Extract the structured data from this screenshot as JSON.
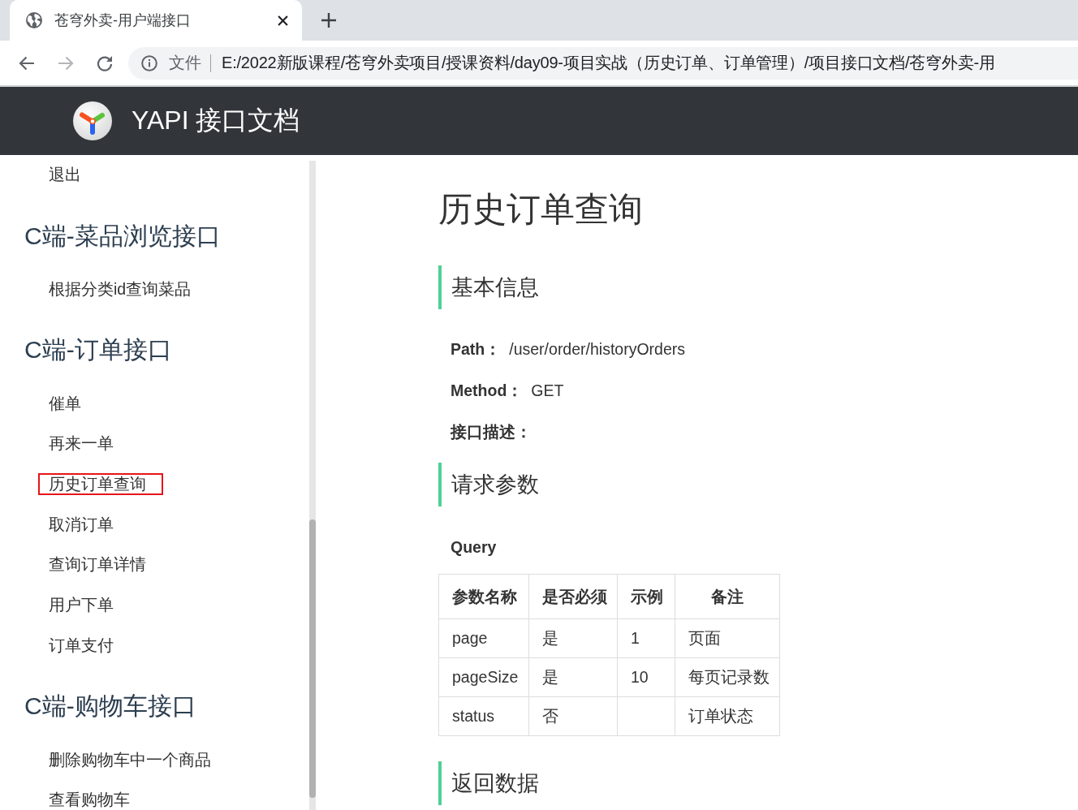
{
  "tabs": [
    {
      "title": "苍穹外卖-用户端接口",
      "selected": true
    }
  ],
  "toolbar": {
    "buttons": [
      {
        "kind": "back",
        "disabled": false
      },
      {
        "kind": "forward",
        "disabled": true
      },
      {
        "kind": "reload",
        "disabled": false
      }
    ],
    "address": {
      "security_label": "文件",
      "url": "E:/2022新版课程/苍穹外卖项目/授课资料/day09-项目实战（历史订单、订单管理）/项目接口文档/苍穹外卖-用"
    }
  },
  "header": {
    "title": "YAPI 接口文档"
  },
  "sidebar": {
    "sections": [
      {
        "items": [
          {
            "label": "退出",
            "highlighted": false
          }
        ]
      },
      {
        "title": "C端-菜品浏览接口",
        "items": [
          {
            "label": "根据分类id查询菜品",
            "highlighted": false
          }
        ]
      },
      {
        "title": "C端-订单接口",
        "items": [
          {
            "label": "催单",
            "highlighted": false
          },
          {
            "label": "再来一单",
            "highlighted": false
          },
          {
            "label": "历史订单查询",
            "highlighted": true
          },
          {
            "label": "取消订单",
            "highlighted": false
          },
          {
            "label": "查询订单详情",
            "highlighted": false
          },
          {
            "label": "用户下单",
            "highlighted": false
          },
          {
            "label": "订单支付",
            "highlighted": false
          }
        ]
      },
      {
        "title": "C端-购物车接口",
        "items": [
          {
            "label": "删除购物车中一个商品",
            "highlighted": false
          },
          {
            "label": "查看购物车",
            "highlighted": false
          }
        ]
      }
    ]
  },
  "content": {
    "title": "历史订单查询",
    "sections": [
      {
        "kind": "info",
        "heading": "基本信息",
        "fields": [
          {
            "label": "Path：",
            "value": "/user/order/historyOrders"
          },
          {
            "label": "Method：",
            "value": "GET"
          },
          {
            "label": "接口描述："
          }
        ]
      },
      {
        "kind": "params",
        "heading": "请求参数",
        "subheading": "Query",
        "table": {
          "columns": [
            "参数名称",
            "是否必须",
            "示例",
            "备注"
          ],
          "rows": [
            {
              "name": "page",
              "required": "是",
              "example": "1",
              "note": "页面"
            },
            {
              "name": "pageSize",
              "required": "是",
              "example": "10",
              "note": "每页记录数"
            },
            {
              "name": "status",
              "required": "否",
              "note": "订单状态"
            }
          ]
        }
      },
      {
        "kind": "heading",
        "heading": "返回数据"
      }
    ]
  }
}
